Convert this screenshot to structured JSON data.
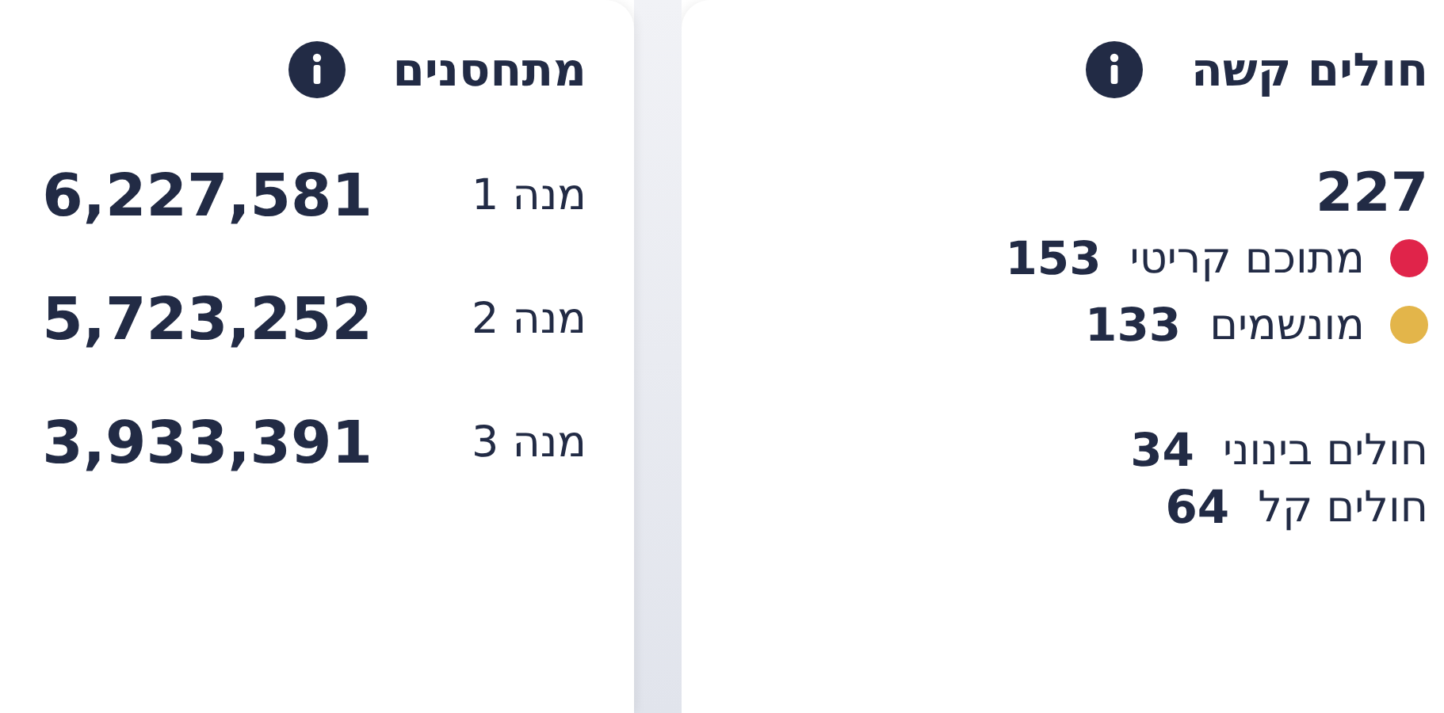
{
  "cards": [
    {
      "title": "חולים קשה",
      "total": "227",
      "details": [
        {
          "label": "מתוכם קריטי",
          "value": "153",
          "color": "#e0244a"
        },
        {
          "label": "מונשמים",
          "value": "133",
          "color": "#e3b54a"
        }
      ],
      "others": [
        {
          "label": "חולים בינוני",
          "value": "34"
        },
        {
          "label": "חולים קל",
          "value": "64"
        }
      ]
    },
    {
      "title": "מתחסנים",
      "doses": [
        {
          "label": "מנה 1",
          "value": "6,227,581"
        },
        {
          "label": "מנה 2",
          "value": "5,723,252"
        },
        {
          "label": "מנה 3",
          "value": "3,933,391"
        }
      ]
    }
  ]
}
